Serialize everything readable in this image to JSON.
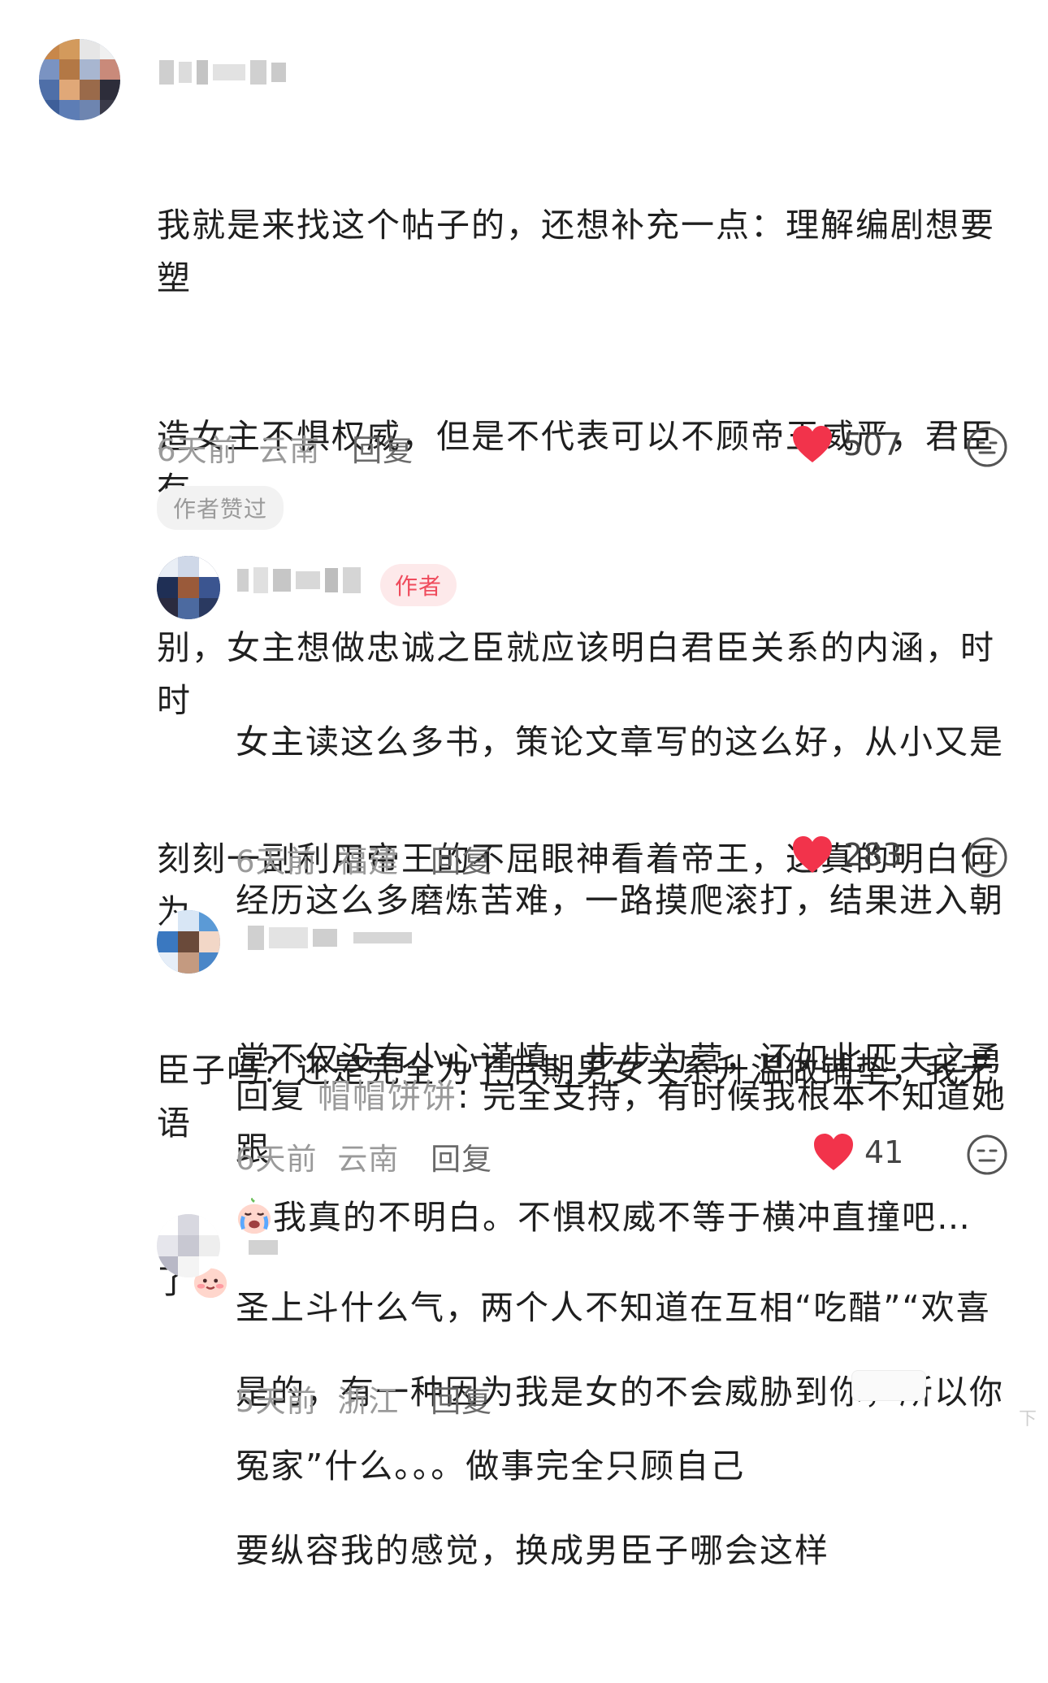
{
  "colors": {
    "like_red": "#f2334b",
    "meta_gray": "#9a9a9a",
    "author_tag_bg": "#fde9ea",
    "author_tag_fg": "#ef4b5c"
  },
  "comments": [
    {
      "line1": "我就是来找这个帖子的，还想补充一点：理解编剧想要塑",
      "line2": "造女主不惧权威，但是不代表可以不顾帝王威严，君臣有",
      "line3": "别，女主想做忠诚之臣就应该明白君臣关系的内涵，时时",
      "line4": "刻刻一副利用帝王的不屈眼神看着帝王，这真的明白何为",
      "line5": "臣子吗？还是完全为了后期男女关系升温做铺垫，我无语",
      "line6": "了",
      "emoji_icon": "blushing-face-icon",
      "time": "6天前",
      "location": "云南",
      "reply_label": "回复",
      "likes": "507",
      "badge": "作者赞过"
    },
    {
      "author_tag": "作者",
      "line1": "女主读这么多书，策论文章写的这么好，从小又是",
      "line2": "经历这么多磨炼苦难，一路摸爬滚打，结果进入朝",
      "line3": "堂不仅没有小心谨慎、步步为营，还如此匹夫之勇",
      "line4": "我真的不明白。不惧权威不等于横冲直撞吧…",
      "emoji_icon": "crying-face-icon",
      "time": "6天前",
      "location": "福建",
      "reply_label": "回复",
      "likes": "283"
    },
    {
      "reply_prefix": "回复",
      "reply_target": "帽帽饼饼",
      "line1": ": 完全支持，有时候我根本不知道她跟",
      "line2": "圣上斗什么气，两个人不知道在互相“吃醋”“欢喜",
      "line3": "冤家”什么。。。做事完全只顾自己",
      "time": "6天前",
      "location": "云南",
      "reply_label": "回复",
      "likes": "41"
    },
    {
      "line1": "是的，有一种因为我是女的不会威胁到你，所以你",
      "line2": "要纵容我的感觉，换成男臣子哪会这样",
      "time": "5天前",
      "location": "浙江",
      "reply_label": "回复"
    }
  ],
  "watermark": "下"
}
